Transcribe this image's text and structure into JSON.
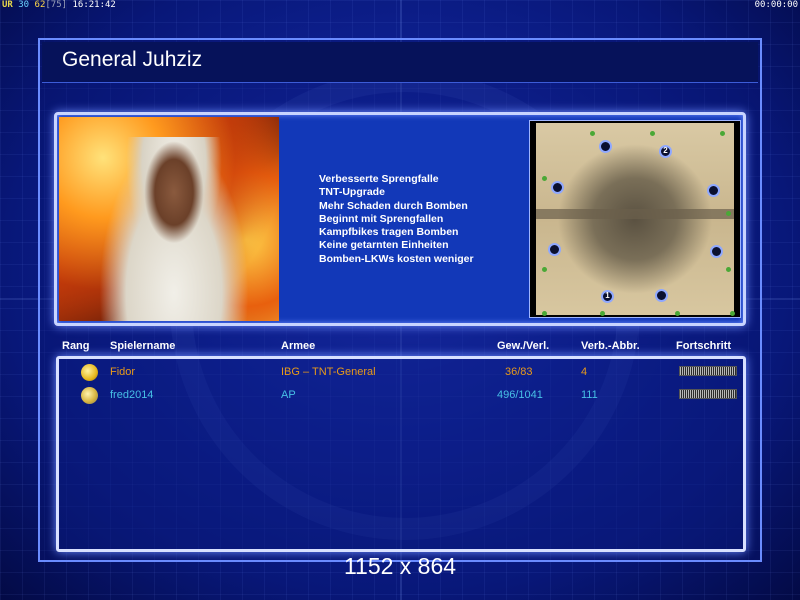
{
  "hud": {
    "ur": "UR",
    "n1": "30",
    "n2": "62",
    "n3": "[75]",
    "clock": "16:21:42",
    "timer": "00:00:00"
  },
  "title": "General Juhziz",
  "traits": [
    "Verbesserte Sprengfalle",
    "TNT-Upgrade",
    "Mehr Schaden durch Bomben",
    "Beginnt mit Sprengfallen",
    "Kampfbikes tragen Bomben",
    "Keine getarnten Einheiten",
    "Bomben-LKWs kosten weniger"
  ],
  "minimap": {
    "spot_labels": [
      "2",
      "1"
    ]
  },
  "table": {
    "headers": {
      "rank": "Rang",
      "player": "Spielername",
      "army": "Armee",
      "winloss": "Gew./Verl.",
      "dc": "Verb.-Abbr.",
      "progress": "Fortschritt"
    },
    "rows": [
      {
        "player": "Fidor",
        "army": "IBG – TNT-General",
        "winloss": "36/83",
        "dc": "4",
        "color": "#e89a1a"
      },
      {
        "player": "fred2014",
        "army": "AP",
        "winloss": "496/1041",
        "dc": "111",
        "color": "#47c0e6"
      }
    ]
  },
  "resolution": "1152 x 864"
}
